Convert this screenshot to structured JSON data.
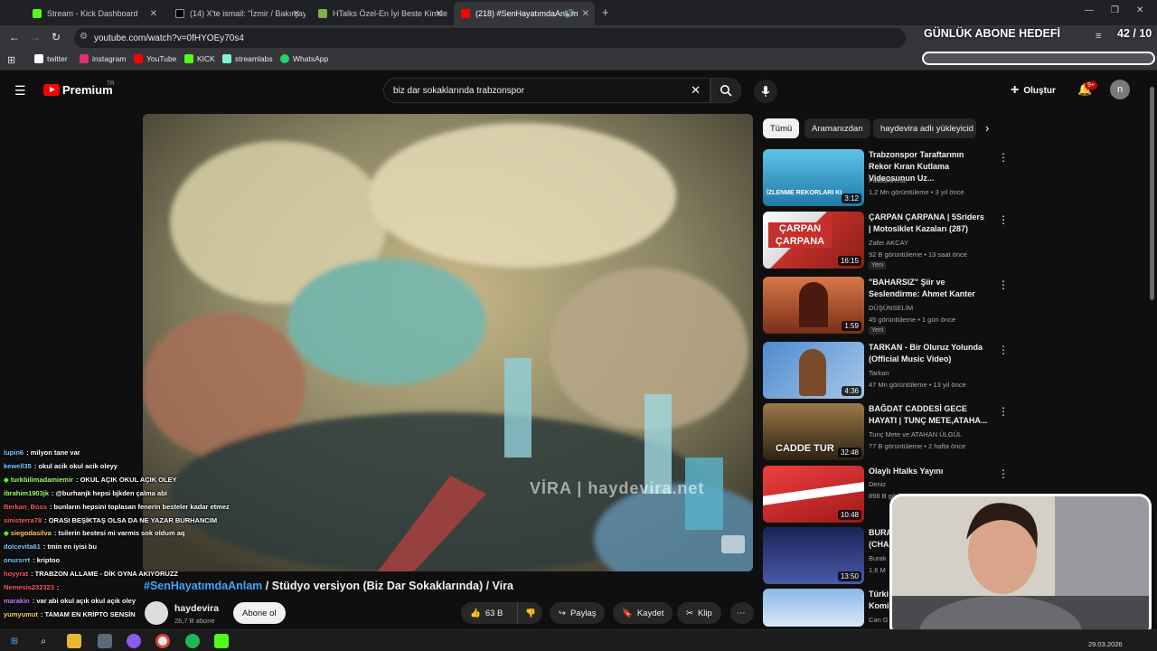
{
  "browser": {
    "tabs": [
      {
        "label": "Stream - Kick Dashboard",
        "icon": "kick-icon",
        "color": "#53fc18"
      },
      {
        "label": "(14) X'te ismail: \"İzmir / Bakırçay",
        "icon": "x-icon",
        "color": "#ffffff"
      },
      {
        "label": "HTalks Özel-En İyi Beste Kimde",
        "icon": "doc-icon",
        "color": "#7cb342"
      },
      {
        "label": "(218) #SenHayatımdaAnlam",
        "icon": "youtube-icon",
        "color": "#ff0000",
        "active": true
      }
    ],
    "url": "youtube.com/watch?v=0fHYOEy70s4",
    "bookmarks": [
      {
        "label": "twitter",
        "color": "#ffffff"
      },
      {
        "label": "instagram",
        "color": "#e1306c"
      },
      {
        "label": "YouTube",
        "color": "#ff0000"
      },
      {
        "label": "KICK",
        "color": "#53fc18"
      },
      {
        "label": "streamlabs",
        "color": "#80f5d2"
      },
      {
        "label": "WhatsApp",
        "color": "#25d366"
      }
    ]
  },
  "overlay": {
    "goal_title": "GÜNLÜK ABONE HEDEFİ",
    "goal_count": "42 / 10"
  },
  "youtube": {
    "logo_text": "Premium",
    "logo_superscript": "TR",
    "search_value": "biz dar sokaklarında trabzonspor",
    "create_label": "Oluştur",
    "notif_badge": "9+",
    "avatar_letter": "n",
    "chips": [
      "Tümü",
      "Aramanızdan",
      "haydevira adlı yükleyicid"
    ],
    "video": {
      "watermark": "VİRA | haydevira.net",
      "title_hashtag": "#SenHayatımdaAnlam",
      "title_rest": " / Stüdyo versiyon (Biz Dar Sokaklarında) / Vira",
      "channel": "haydevira",
      "subs": "26,7 B abone",
      "subscribe": "Abone ol",
      "likes": "63 B",
      "share": "Paylaş",
      "save": "Kaydet",
      "clip": "Klip"
    },
    "recommendations": [
      {
        "title": "Trabzonspor Taraftarının Rekor Kıran Kutlama Videosunun Uz...",
        "channel": "FutbolArena",
        "meta": "1,2 Mn görüntüleme • 3 yıl önce",
        "duration": "3:12",
        "thumb_color": "#2a9fcf",
        "thumb_text": "İZLENME REKORLARI KI"
      },
      {
        "title": "ÇARPAN ÇARPANA | 5Sriders | Motosiklet Kazaları (287)",
        "channel": "Zafer AKCAY",
        "meta": "92 B görüntüleme • 13 saat önce",
        "new": "Yeni",
        "duration": "16:15",
        "thumb_color": "#c4302b",
        "thumb_text": "ÇARPAN ÇARPANA"
      },
      {
        "title": "\"BAHARSIZ\" Şiir ve Seslendirme: Ahmet Kanter",
        "channel": "DÜŞÜNSELİM",
        "meta": "45 görüntüleme • 1 gün önce",
        "new": "Yeni",
        "duration": "1:59",
        "thumb_color": "#b5502a",
        "thumb_text": ""
      },
      {
        "title": "TARKAN - Bir Oluruz Yolunda (Official Music Video)",
        "channel": "Tarkan",
        "meta": "47 Mn görüntüleme • 13 yıl önce",
        "duration": "4:36",
        "thumb_color": "#3b6fb5",
        "thumb_text": ""
      },
      {
        "title": "BAĞDAT CADDESİ GECE HAYATI | TUNÇ METE,ATAHA...",
        "channel": "Tunç Mete ve ATAHAN ÜLGÜL",
        "meta": "77 B görüntüleme • 2 hafta önce",
        "duration": "32:48",
        "thumb_color": "#5a4024",
        "thumb_text": "CADDE TUR"
      },
      {
        "title": "Olaylı Htalks Yayını",
        "channel": "Deniz",
        "meta": "898 B görüntüleme",
        "duration": "10:48",
        "thumb_color": "#d62b2b",
        "thumb_text": ""
      },
      {
        "title": "BURA (CHA",
        "channel": "Burak",
        "meta": "1,6 M",
        "duration": "13:50",
        "thumb_color": "#2b3a7a",
        "thumb_text": ""
      },
      {
        "title": "Türki Komi",
        "channel": "Can G",
        "meta": "",
        "duration": "",
        "thumb_color": "#6fa0d8",
        "thumb_text": ""
      }
    ]
  },
  "chat": [
    {
      "user": "lupin6",
      "msg": ": milyon tane var",
      "color": "#7ec8ff"
    },
    {
      "user": "kewell35",
      "msg": ": okul acik okul acik oleyy",
      "color": "#7ec8ff"
    },
    {
      "user": "turkbilimadamiemir",
      "msg": ": OKUL AÇIK OKUL AÇIK OLEY",
      "color": "#9cff6b",
      "badge": true
    },
    {
      "user": "ibrahim1903jk",
      "msg": ": @burhanjk hepsi bjkden çalma abi",
      "color": "#9cff6b"
    },
    {
      "user": "Berkan_Boss",
      "msg": ": bunların hepsini toplasan fenerin besteler kadar etmez",
      "color": "#ff5a5a"
    },
    {
      "user": "sinisterra78",
      "msg": ": ORASI BEŞİKTAŞ OLSA DA NE YAZAR BURHANCIM",
      "color": "#ff5a5a"
    },
    {
      "user": "siegodasilva",
      "msg": ": tsilerin bestesi mi varmis sok oldum aq",
      "color": "#ffd24d",
      "badge": true
    },
    {
      "user": "dolcevita61",
      "msg": ": tmin en iyisi bu",
      "color": "#7ec8ff"
    },
    {
      "user": "onursrrt",
      "msg": ": kriptoo",
      "color": "#7ec8ff"
    },
    {
      "user": "hoyyrat",
      "msg": ": TRABZON ALLAME - DİK OYNA AKIYORUZZ",
      "color": "#ff5a5a"
    },
    {
      "user": "Nemesis232323",
      "msg": ":",
      "color": "#ff5a5a"
    },
    {
      "user": "marakin",
      "msg": ": var abi okul açık okul açık oley",
      "color": "#c77dff"
    },
    {
      "user": "yumyumut",
      "msg": ": TAMAM EN KRİPTO SENSİN",
      "color": "#ffd24d"
    }
  ],
  "taskbar": {
    "date": "29.03.2026"
  }
}
